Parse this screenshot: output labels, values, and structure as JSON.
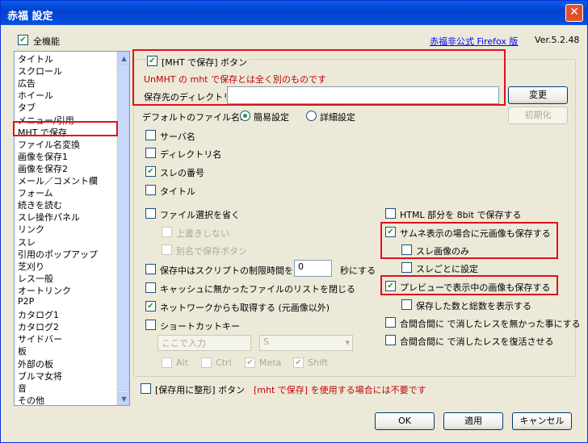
{
  "window": {
    "title": "赤福 設定",
    "close": "✕"
  },
  "top": {
    "all_features": "全機能",
    "link": "赤福非公式 Firefox 版",
    "version": "Ver.5.2.48"
  },
  "sidebar": {
    "items": [
      "タイトル",
      "スクロール",
      "広告",
      "ホイール",
      "タブ",
      "メニュー/引用",
      "MHT で保存",
      "ファイル名変換",
      "画像を保存1",
      "画像を保存2",
      "メール／コメント欄",
      "フォーム",
      "続きを読む",
      "スレ操作パネル",
      "リンク",
      "スレ",
      "引用のポップアップ",
      "芝刈り",
      "レス一般",
      "オートリンク",
      "P2P",
      "カタログ1",
      "カタログ2",
      "サイドバー",
      "板",
      "外部の板",
      "ブルマ女将",
      "音",
      "その他"
    ]
  },
  "mht": {
    "button_label": "[MHT で保存] ボタン",
    "warning": "UnMHT の mht で保存とは全く別のものです",
    "dir_label": "保存先のディレクトリ",
    "change": "変更",
    "init": "初期化",
    "filename_label": "デフォルトのファイル名:",
    "simple": "簡易設定",
    "detail": "詳細設定",
    "server": "サーバ名",
    "dir": "ディレクトリ名",
    "thread_no": "スレの番号",
    "title": "タイトル",
    "skip_select": "ファイル選択を省く",
    "no_overwrite": "上書きしない",
    "save_as_btn": "別名で保存ボタン",
    "script_limit": "保存中はスクリプトの制限時間を",
    "script_value": "0",
    "seconds": "秒にする",
    "close_list": "キャッシュに無かったファイルのリストを閉じる",
    "network": "ネットワークからも取得する (元画像以外)",
    "shortcut": "ショートカットキー",
    "shortcut_placeholder": "ここで入力",
    "shortcut_key": "S",
    "alt": "Alt",
    "ctrl": "Ctrl",
    "meta": "Meta",
    "shift": "Shift",
    "html8bit": "HTML 部分を 8bit で保存する",
    "thumb_original": "サムネ表示の場合に元画像も保存する",
    "thread_images_only": "スレ画像のみ",
    "per_thread": "スレごとに設定",
    "preview_images": "プレビューで表示中の画像も保存する",
    "show_counts": "保存した数と総数を表示する",
    "aikan1": "合間合間に で消したレスを無かった事にする",
    "aikan2": "合間合間に で消したレスを復活させる",
    "format_btn": "[保存用に整形] ボタン",
    "format_note": "[mht で保存] を使用する場合には不要です"
  },
  "footer": {
    "ok": "OK",
    "apply": "適用",
    "cancel": "キャンセル"
  }
}
